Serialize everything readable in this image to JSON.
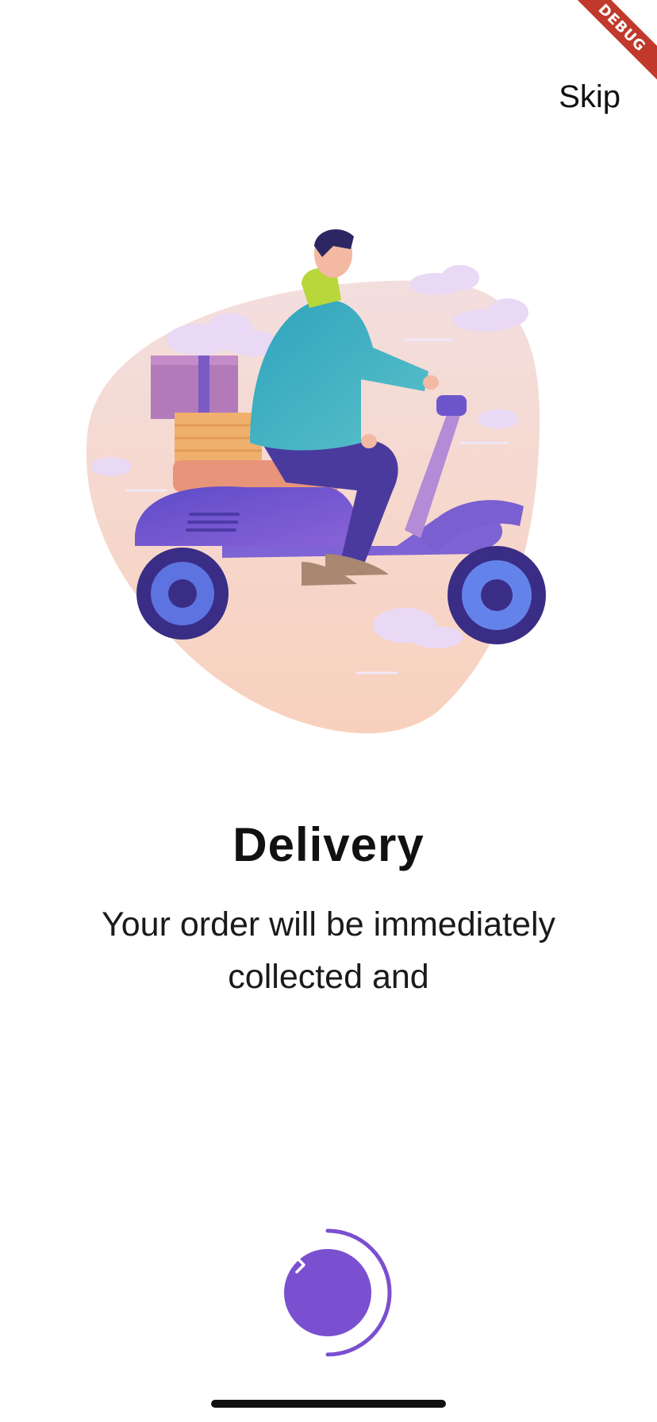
{
  "debug_banner": {
    "label": "DEBUG"
  },
  "header": {
    "skip_label": "Skip"
  },
  "onboarding": {
    "title": "Delivery",
    "description": "Your order will be immediately collected and",
    "illustration": "delivery-scooter-illustration",
    "progress": 0.5
  },
  "navigation": {
    "next_icon": "chevron-right-icon"
  },
  "colors": {
    "accent": "#7a4fd0",
    "blob": "#f6d3c8",
    "scooter": "#6a4fc9",
    "jacket": "#34a9bd",
    "debug_banner": "#c0392b"
  }
}
